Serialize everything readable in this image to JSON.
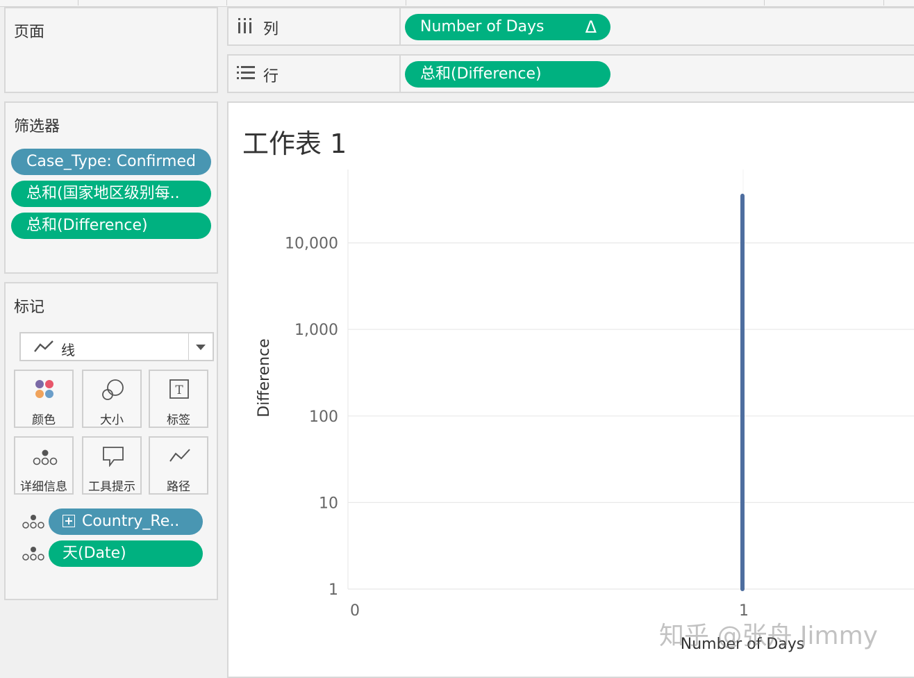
{
  "pages_panel": {
    "title": "页面"
  },
  "filters_panel": {
    "title": "筛选器",
    "items": [
      {
        "label": "Case_Type: Confirmed",
        "color": "#4996b2"
      },
      {
        "label": "总和(国家地区级别每..",
        "color": "#00b180"
      },
      {
        "label": "总和(Difference)",
        "color": "#00b180"
      }
    ]
  },
  "marks_panel": {
    "title": "标记",
    "type_label": "线",
    "buttons": {
      "color": "颜色",
      "size": "大小",
      "label": "标签",
      "detail": "详细信息",
      "tooltip": "工具提示",
      "path": "路径"
    },
    "fields": [
      {
        "label": "Country_Re..",
        "color": "#4996b2"
      },
      {
        "label": "天(Date)",
        "color": "#00b180"
      }
    ]
  },
  "shelves": {
    "columns": {
      "label": "列",
      "pill": "Number of Days",
      "pill_glyph": "Δ"
    },
    "rows": {
      "label": "行",
      "pill": "总和(Difference)"
    }
  },
  "sheet": {
    "title": "工作表 1"
  },
  "watermark": "知乎 @张舟 Jimmy",
  "colors": {
    "green": "#00b180",
    "blue": "#4996b2",
    "line": "#4e6e9f"
  },
  "chart_data": {
    "type": "line",
    "xlabel": "Number of Days",
    "ylabel": "Difference",
    "x_ticks": [
      "0",
      "1"
    ],
    "y_ticks": [
      "1",
      "10",
      "100",
      "1,000",
      "10,000"
    ],
    "y_scale": "log",
    "grid": true,
    "series": [
      {
        "x": [
          1,
          1
        ],
        "y": [
          1,
          35000
        ]
      }
    ]
  }
}
